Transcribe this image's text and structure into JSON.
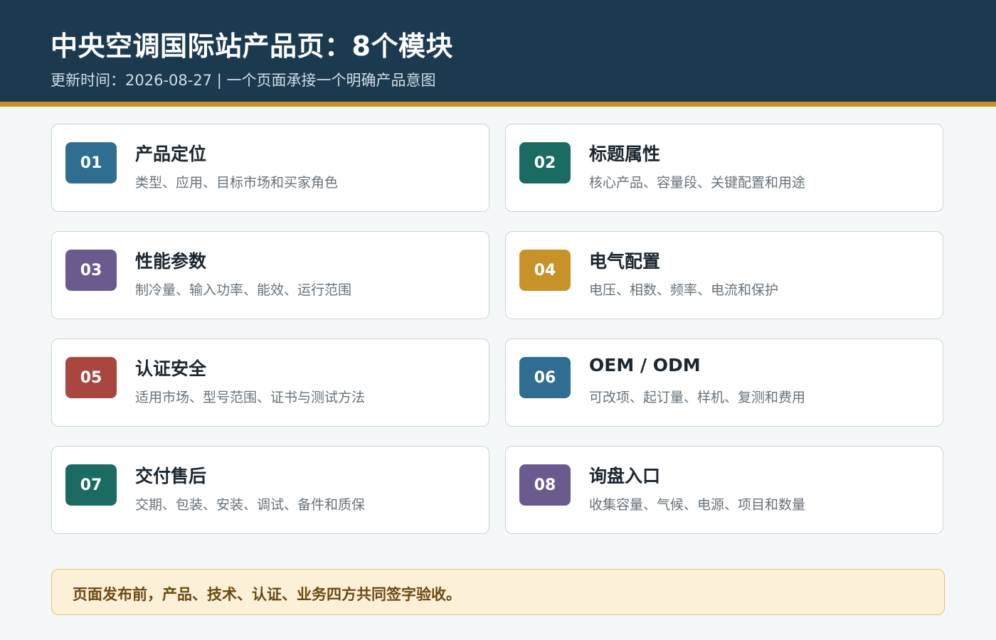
{
  "header": {
    "title": "中央空调国际站产品页：8个模块",
    "subtitle": "更新时间：2026-08-27 | 一个页面承接一个明确产品意图"
  },
  "modules": [
    {
      "num": "01",
      "title": "产品定位",
      "desc": "类型、应用、目标市场和买家角色",
      "color": "#2f6d91"
    },
    {
      "num": "02",
      "title": "标题属性",
      "desc": "核心产品、容量段、关键配置和用途",
      "color": "#1a6b62"
    },
    {
      "num": "03",
      "title": "性能参数",
      "desc": "制冷量、输入功率、能效、运行范围",
      "color": "#6a5a8e"
    },
    {
      "num": "04",
      "title": "电气配置",
      "desc": "电压、相数、频率、电流和保护",
      "color": "#c99228"
    },
    {
      "num": "05",
      "title": "认证安全",
      "desc": "适用市场、型号范围、证书与测试方法",
      "color": "#a8463f"
    },
    {
      "num": "06",
      "title": "OEM / ODM",
      "desc": "可改项、起订量、样机、复测和费用",
      "color": "#2f6d91"
    },
    {
      "num": "07",
      "title": "交付售后",
      "desc": "交期、包装、安装、调试、备件和质保",
      "color": "#1a6b62"
    },
    {
      "num": "08",
      "title": "询盘入口",
      "desc": "收集容量、气候、电源、项目和数量",
      "color": "#6a5a8e"
    }
  ],
  "footer_note": "页面发布前，产品、技术、认证、业务四方共同签字验收。"
}
